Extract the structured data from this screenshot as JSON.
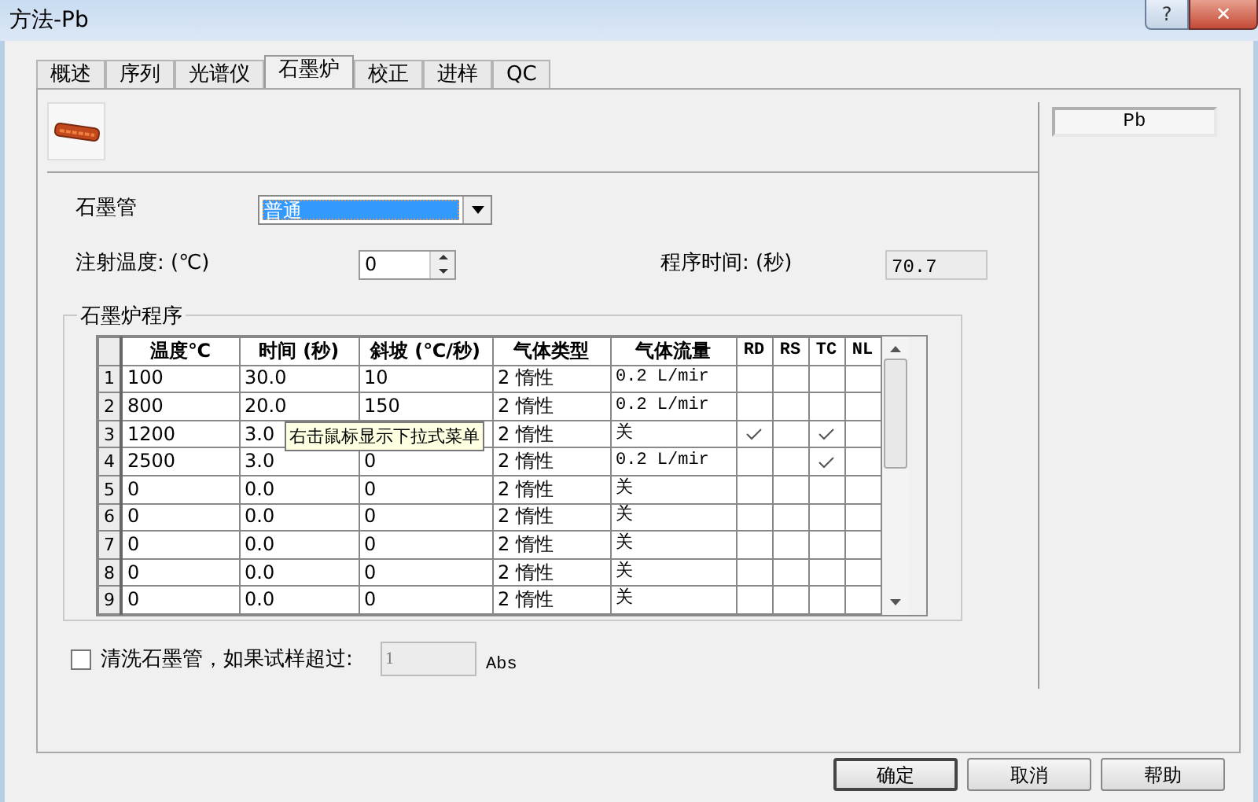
{
  "window": {
    "title": "方法-Pb",
    "help": "?",
    "close": "✕"
  },
  "tabs": [
    {
      "label": "概述",
      "selected": false
    },
    {
      "label": "序列",
      "selected": false
    },
    {
      "label": "光谱仪",
      "selected": false
    },
    {
      "label": "石墨炉",
      "selected": true
    },
    {
      "label": "校正",
      "selected": false
    },
    {
      "label": "进样",
      "selected": false
    },
    {
      "label": "QC",
      "selected": false
    }
  ],
  "tube": {
    "label": "石墨管",
    "value": "普通"
  },
  "injection_temp": {
    "label": "注射温度: (℃)",
    "value": "0"
  },
  "program_time": {
    "label": "程序时间: (秒)",
    "value": "70.7"
  },
  "program": {
    "title": "石墨炉程序",
    "columns": [
      "温度℃",
      "时间 (秒)",
      "斜坡 (℃/秒)",
      "气体类型",
      "气体流量",
      "RD",
      "RS",
      "TC",
      "NL"
    ],
    "rows": [
      {
        "number": "1",
        "temp": "100",
        "time": "30.0",
        "ramp": "10",
        "gas": "2 惰性",
        "flow": "0.2 L/mir",
        "rd": false,
        "rs": false,
        "tc": false,
        "nl": false
      },
      {
        "number": "2",
        "temp": "800",
        "time": "20.0",
        "ramp": "150",
        "gas": "2 惰性",
        "flow": "0.2 L/mir",
        "rd": false,
        "rs": false,
        "tc": false,
        "nl": false
      },
      {
        "number": "3",
        "temp": "1200",
        "time": "3.0",
        "gas": "2 惰性",
        "flow": "关",
        "rd": true,
        "rs": false,
        "tc": true,
        "nl": false
      },
      {
        "number": "4",
        "temp": "2500",
        "time": "3.0",
        "ramp": "0",
        "gas": "2 惰性",
        "flow": "0.2 L/mir",
        "rd": false,
        "rs": false,
        "tc": true,
        "nl": false
      },
      {
        "number": "5",
        "temp": "0",
        "time": "0.0",
        "ramp": "0",
        "gas": "2 惰性",
        "flow": "关",
        "rd": false,
        "rs": false,
        "tc": false,
        "nl": false
      },
      {
        "number": "6",
        "temp": "0",
        "time": "0.0",
        "ramp": "0",
        "gas": "2 惰性",
        "flow": "关",
        "rd": false,
        "rs": false,
        "tc": false,
        "nl": false
      },
      {
        "number": "7",
        "temp": "0",
        "time": "0.0",
        "ramp": "0",
        "gas": "2 惰性",
        "flow": "关",
        "rd": false,
        "rs": false,
        "tc": false,
        "nl": false
      },
      {
        "number": "8",
        "temp": "0",
        "time": "0.0",
        "ramp": "0",
        "gas": "2 惰性",
        "flow": "关",
        "rd": false,
        "rs": false,
        "tc": false,
        "nl": false
      },
      {
        "number": "9",
        "temp": "0",
        "time": "0.0",
        "ramp": "0",
        "gas": "2 惰性",
        "flow": "关",
        "rd": false,
        "rs": false,
        "tc": false,
        "nl": false
      }
    ],
    "tooltip": "右击鼠标显示下拉式菜单"
  },
  "clean": {
    "label": "清洗石墨管，如果试样超过:",
    "checked": false,
    "value": "1",
    "unit": "Abs"
  },
  "elements": [
    "Pb"
  ],
  "buttons": [
    {
      "label": "确定",
      "default": true
    },
    {
      "label": "取消",
      "default": false
    },
    {
      "label": "帮助",
      "default": false
    }
  ]
}
